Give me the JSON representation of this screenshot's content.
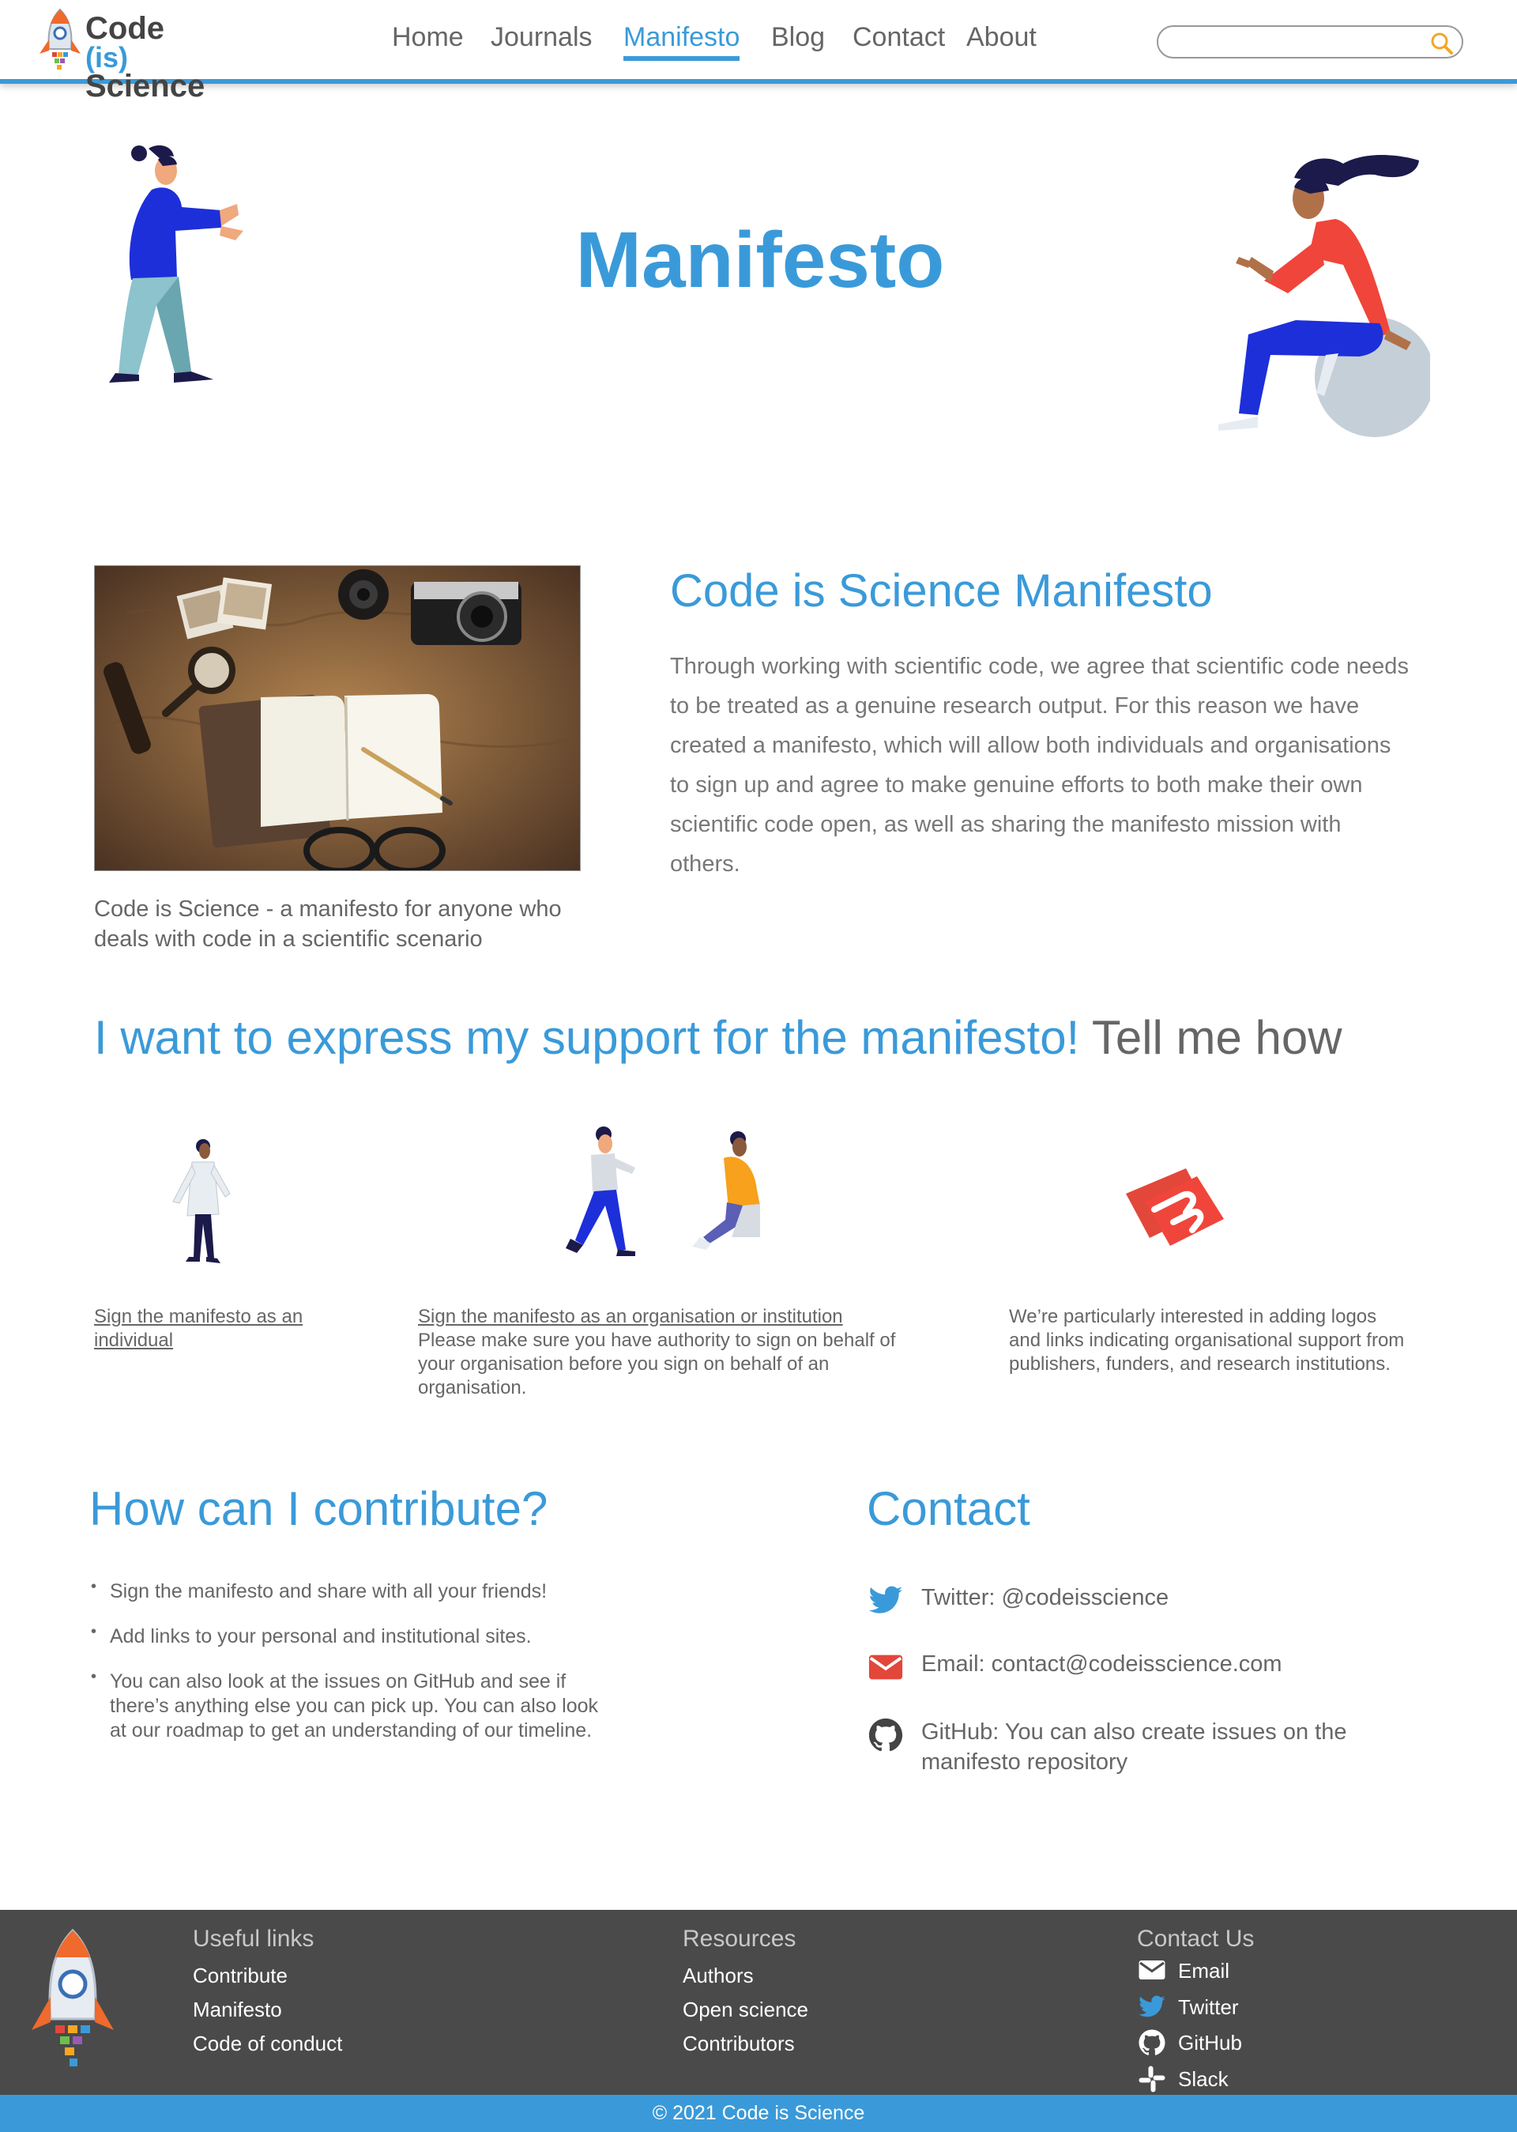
{
  "header": {
    "logo": {
      "code": "Code",
      "is": "(is)",
      "science": "Science"
    },
    "nav": [
      "Home",
      "Journals",
      "Manifesto",
      "Blog",
      "Contact",
      "About"
    ],
    "active_nav": "Manifesto",
    "search": {
      "value": "",
      "placeholder": ""
    }
  },
  "hero": {
    "title": "Manifesto"
  },
  "intro": {
    "caption": "Code is Science - a manifesto for anyone who deals with code in a scientific scenario",
    "title": "Code is Science Manifesto",
    "text": "Through working with scientific code, we agree that scientific code needs to be treated as a genuine research output. For this reason we have created a manifesto, which will allow both individuals and organisations to sign up and agree to make genuine efforts to both make their own scientific code open, as well as sharing the manifesto mission with others."
  },
  "support": {
    "title": "I want to express my support for the manifesto!",
    "tell": "Tell me how",
    "individual_link": "Sign the manifesto as an individual",
    "org_link": "Sign the manifesto as an organisation or institution",
    "org_note": "Please make sure you have authority to sign on behalf of your organisation before you sign on behalf of an organisation.",
    "logos_note": "We’re particularly interested in adding logos and links indicating organisational support from publishers, funders, and research institutions."
  },
  "contribute": {
    "title": "How can I contribute?",
    "items": [
      "Sign the manifesto and share with all your friends!",
      "Add links to your personal and institutional sites.",
      "You can also look at the issues on GitHub and see if there’s anything else you can pick up. You can also look at our roadmap to get an understanding of our timeline."
    ]
  },
  "contact": {
    "title": "Contact",
    "twitter": "Twitter: @codeisscience",
    "email": "Email: contact@codeisscience.com",
    "github": "GitHub: You can also create issues on the manifesto repository"
  },
  "footer": {
    "useful_title": "Useful links",
    "useful": [
      "Contribute",
      "Manifesto",
      "Code of conduct"
    ],
    "resources_title": "Resources",
    "resources": [
      "Authors",
      "Open science",
      "Contributors"
    ],
    "contact_title": "Contact Us",
    "contact": [
      "Email",
      "Twitter",
      "GitHub",
      "Slack"
    ],
    "copyright": "© 2021 Code is Science"
  },
  "colors": {
    "accent": "#3a9ad9",
    "text": "#666666",
    "footer_bg": "#4a4a4a",
    "twitter": "#3a9ad9",
    "email": "#e2473a",
    "search": "#f5a623"
  },
  "icons": [
    "search-icon",
    "twitter-icon",
    "email-icon",
    "github-icon",
    "slack-icon",
    "rocket-icon"
  ]
}
